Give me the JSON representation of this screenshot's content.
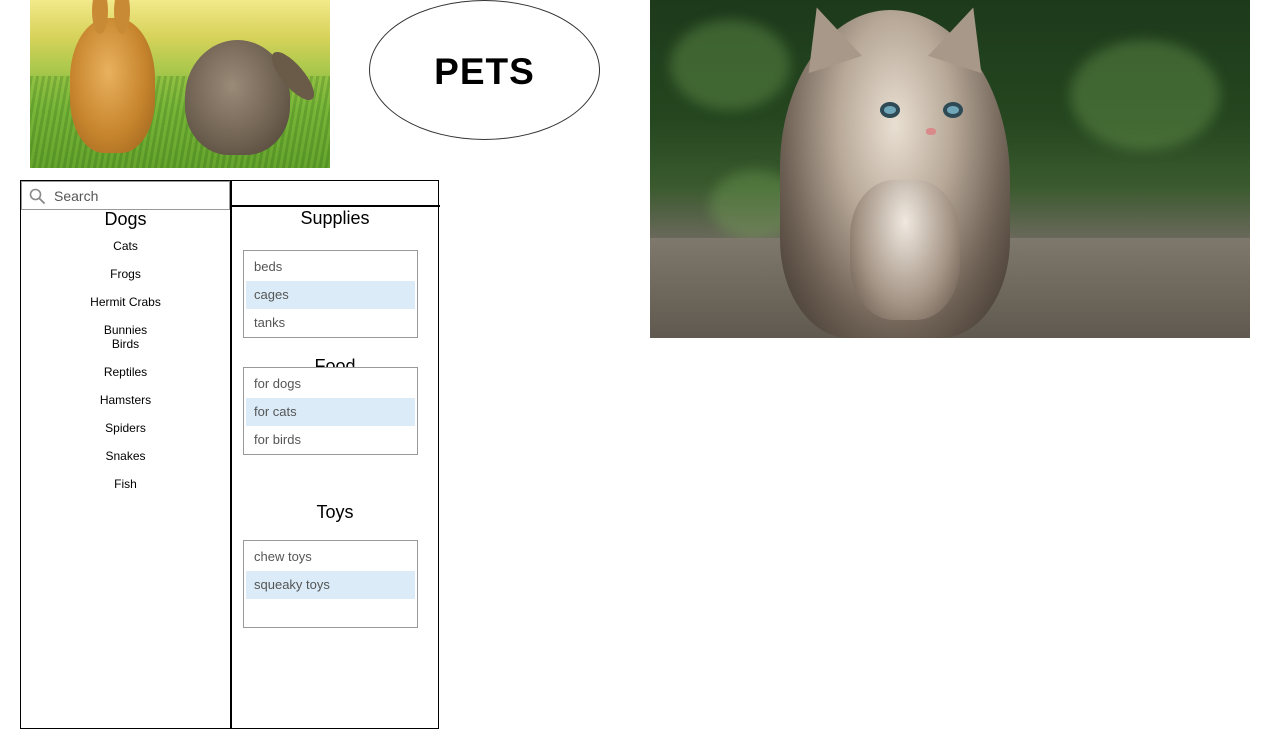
{
  "title": "PETS",
  "search": {
    "placeholder": "Search"
  },
  "categories": {
    "heading": "Dogs",
    "items": [
      "Cats",
      "Frogs",
      "Hermit Crabs",
      "Bunnies\nBirds",
      "Reptiles",
      "Hamsters",
      "Spiders",
      "Snakes",
      "Fish"
    ]
  },
  "supplies": {
    "title": "Supplies",
    "items": [
      "beds",
      "cages",
      "tanks"
    ],
    "selected": "cages"
  },
  "food": {
    "title": "Food",
    "items": [
      "for dogs",
      "for cats",
      "for birds"
    ],
    "selected": "for cats"
  },
  "toys": {
    "title": "Toys",
    "items": [
      "chew toys",
      "squeaky toys",
      ""
    ],
    "selected": "squeaky toys"
  },
  "colors": {
    "selected_row": "#dbecf8",
    "border": "#000000",
    "list_border": "#999999"
  }
}
